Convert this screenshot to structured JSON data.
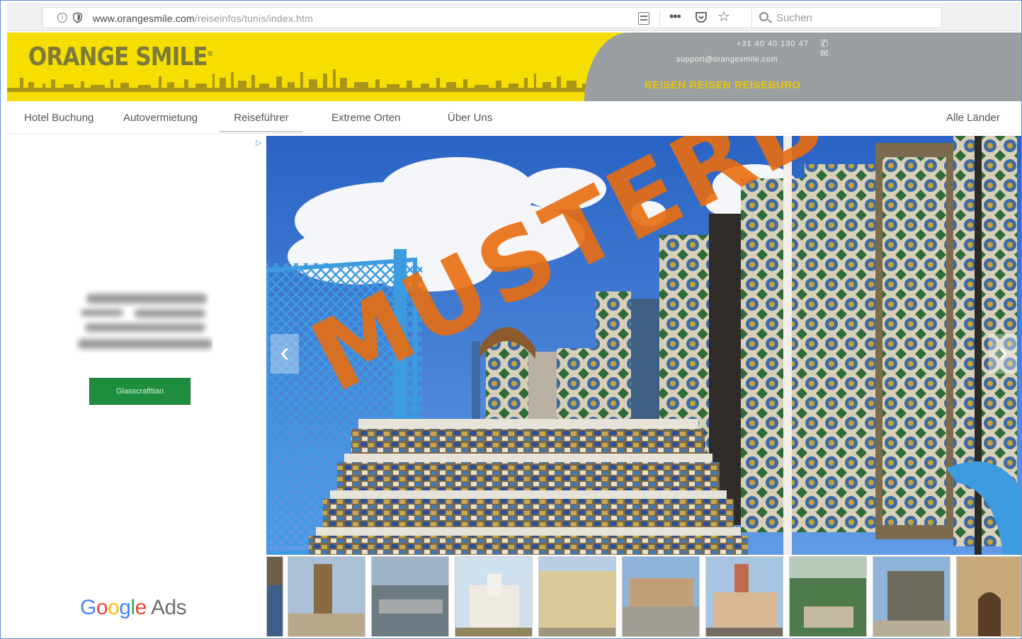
{
  "browser": {
    "url_host": "www.orangesmile.com",
    "url_path": "/reiseinfos/tunis/index.htm",
    "search_placeholder": "Suchen",
    "icons": [
      "info-icon",
      "shield-icon",
      "reader-view-icon",
      "more-icon",
      "pocket-icon",
      "bookmark-star-icon",
      "search-icon"
    ]
  },
  "banner": {
    "logo": "ORANGE SMILE",
    "logo_tm": "®",
    "phone": "+31 40 40 130 47",
    "email": "support@orangesmile.com",
    "tagline": "REISEN REISEN REISEBURO",
    "colors": {
      "background": "#f6de00",
      "panel": "#9aa0a2",
      "logo": "#7d7a3a"
    }
  },
  "nav": {
    "items": [
      {
        "label": "Hotel Buchung"
      },
      {
        "label": "Autovermietung"
      },
      {
        "label": "Reiseführer"
      },
      {
        "label": "Extreme Orten"
      },
      {
        "label": "Über Uns"
      }
    ],
    "active": "Reiseführer",
    "right_label": "Alle Länder"
  },
  "ad": {
    "button_label": "Glasscrafttian",
    "brand_google": [
      "G",
      "o",
      "o",
      "g",
      "l",
      "e"
    ],
    "brand_ads": "Ads"
  },
  "hero": {
    "watermark": "MUSTERBILD",
    "prev_arrow": "‹",
    "next_arrow": "›"
  },
  "thumbnails": {
    "count": 10
  }
}
